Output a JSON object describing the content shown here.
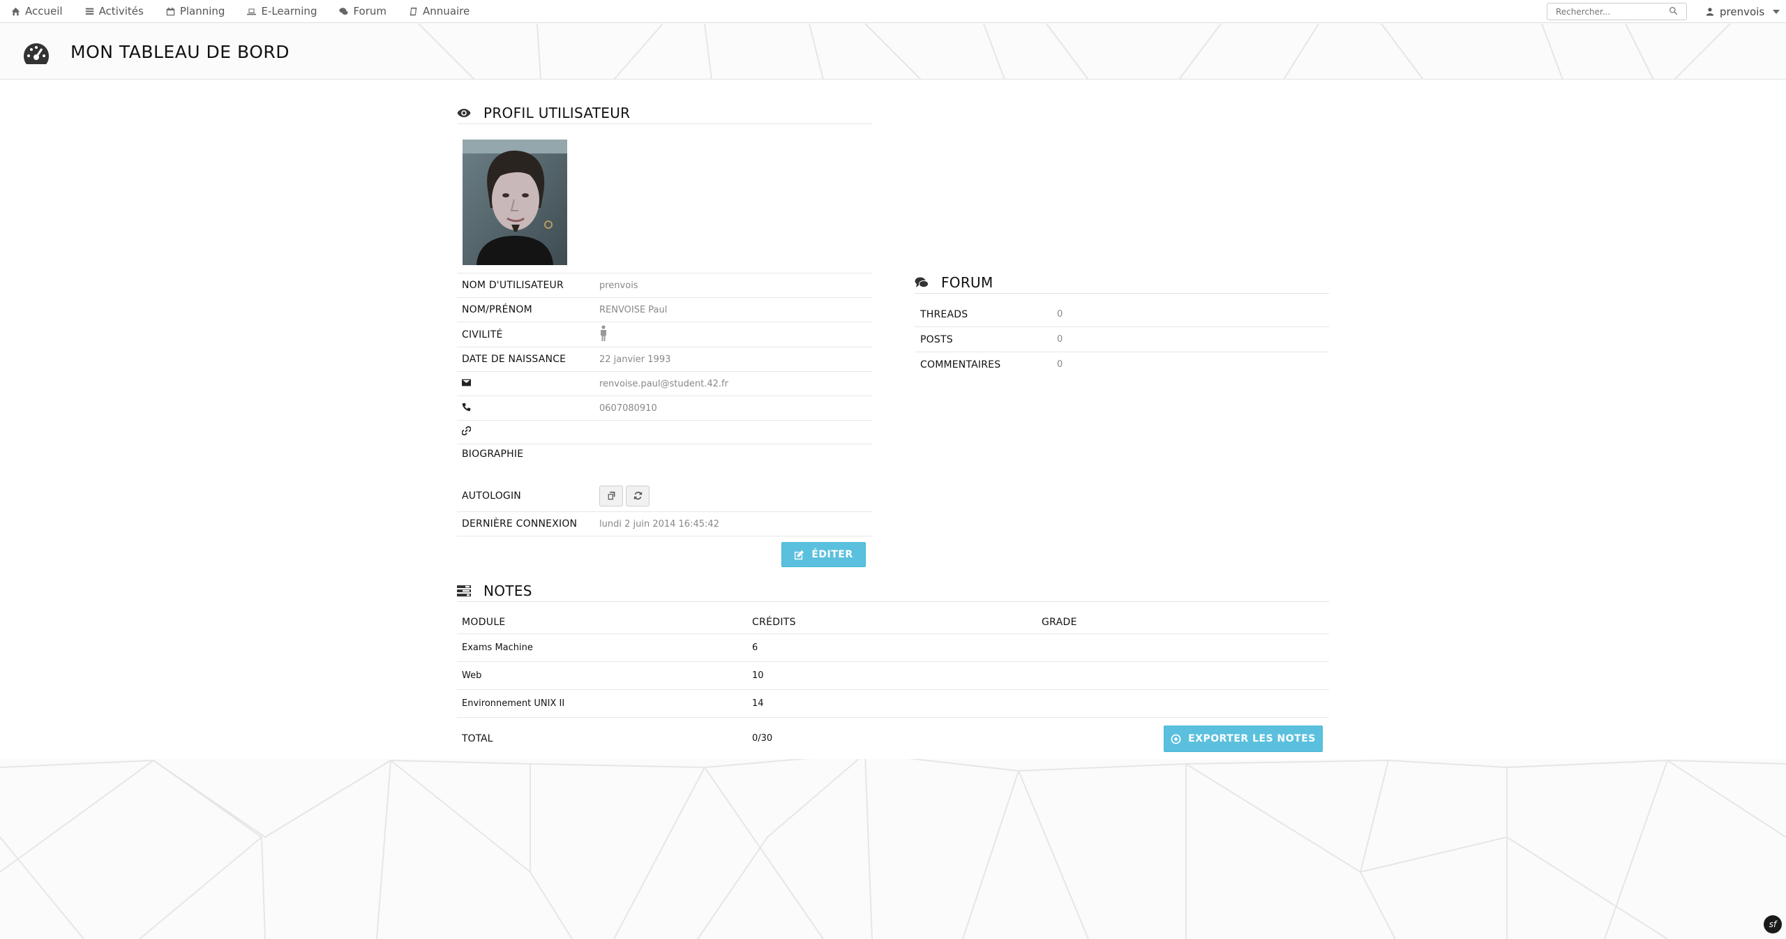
{
  "nav": {
    "items": [
      {
        "label": "Accueil",
        "icon": "home-icon"
      },
      {
        "label": "Activités",
        "icon": "list-icon"
      },
      {
        "label": "Planning",
        "icon": "calendar-icon"
      },
      {
        "label": "E-Learning",
        "icon": "laptop-icon"
      },
      {
        "label": "Forum",
        "icon": "comments-icon"
      },
      {
        "label": "Annuaire",
        "icon": "book-icon"
      }
    ],
    "search_placeholder": "Rechercher...",
    "username": "prenvois"
  },
  "header": {
    "title": "MON TABLEAU DE BORD"
  },
  "profile": {
    "title": "PROFIL UTILISATEUR",
    "rows": {
      "username_label": "NOM D'UTILISATEUR",
      "username_value": "prenvois",
      "name_label": "NOM/PRÉNOM",
      "name_value": "RENVOISE Paul",
      "civility_label": "CIVILITÉ",
      "birth_label": "DATE DE NAISSANCE",
      "birth_value": "22 janvier 1993",
      "email_value": "renvoise.paul@student.42.fr",
      "phone_value": "0607080910",
      "bio_label": "BIOGRAPHIE",
      "autologin_label": "AUTOLOGIN",
      "last_login_label": "DERNIÈRE CONNEXION",
      "last_login_value": "lundi 2 juin 2014 16:45:42"
    },
    "edit_label": "ÉDITER"
  },
  "forum": {
    "title": "FORUM",
    "rows": [
      {
        "label": "THREADS",
        "value": "0"
      },
      {
        "label": "POSTS",
        "value": "0"
      },
      {
        "label": "COMMENTAIRES",
        "value": "0"
      }
    ]
  },
  "notes": {
    "title": "NOTES",
    "headers": {
      "module": "MODULE",
      "credits": "CRÉDITS",
      "grade": "GRADE"
    },
    "rows": [
      {
        "module": "Exams Machine",
        "credits": "6",
        "grade": ""
      },
      {
        "module": "Web",
        "credits": "10",
        "grade": ""
      },
      {
        "module": "Environnement UNIX II",
        "credits": "14",
        "grade": ""
      }
    ],
    "total_label": "TOTAL",
    "total_value": "0/30",
    "export_label": "EXPORTER LES NOTES"
  },
  "colors": {
    "accent": "#5bc0de",
    "text": "#222222",
    "muted": "#888888"
  },
  "footer": {
    "badge": "sf"
  }
}
